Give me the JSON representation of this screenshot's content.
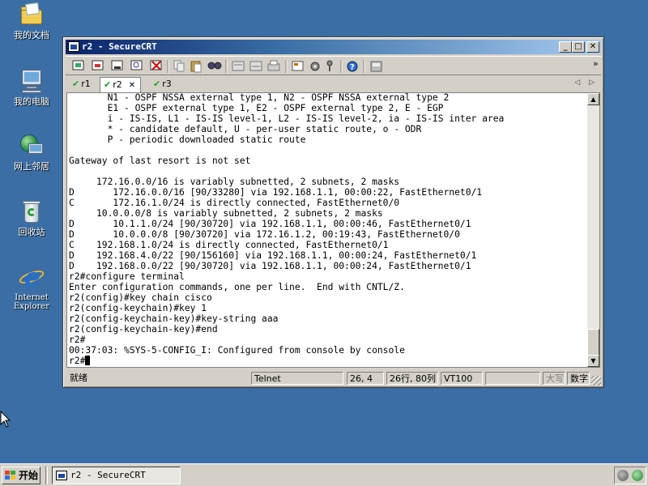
{
  "desktop": {
    "icons": [
      {
        "label": "我的文档"
      },
      {
        "label": "我的电脑"
      },
      {
        "label": "网上邻居"
      },
      {
        "label": "回收站"
      },
      {
        "label": "Internet Explorer"
      }
    ]
  },
  "window": {
    "title": "r2 - SecureCRT",
    "min_glyph": "_",
    "max_glyph": "□",
    "close_glyph": "✕",
    "tabs": [
      {
        "label": "r1",
        "active": false
      },
      {
        "label": "r2",
        "active": true
      },
      {
        "label": "r3",
        "active": false
      }
    ],
    "tab_close_glyph": "✕",
    "tab_nav_prev": "◁",
    "tab_nav_next": "▷",
    "terminal_text": "       N1 - OSPF NSSA external type 1, N2 - OSPF NSSA external type 2\n       E1 - OSPF external type 1, E2 - OSPF external type 2, E - EGP\n       i - IS-IS, L1 - IS-IS level-1, L2 - IS-IS level-2, ia - IS-IS inter area\n       * - candidate default, U - per-user static route, o - ODR\n       P - periodic downloaded static route\n\nGateway of last resort is not set\n\n     172.16.0.0/16 is variably subnetted, 2 subnets, 2 masks\nD       172.16.0.0/16 [90/33280] via 192.168.1.1, 00:00:22, FastEthernet0/1\nC       172.16.1.0/24 is directly connected, FastEthernet0/0\n     10.0.0.0/8 is variably subnetted, 2 subnets, 2 masks\nD       10.1.1.0/24 [90/30720] via 192.168.1.1, 00:00:46, FastEthernet0/1\nD       10.0.0.0/8 [90/30720] via 172.16.1.2, 00:19:43, FastEthernet0/0\nC    192.168.1.0/24 is directly connected, FastEthernet0/1\nD    192.168.4.0/22 [90/156160] via 192.168.1.1, 00:00:24, FastEthernet0/1\nD    192.168.0.0/22 [90/30720] via 192.168.1.1, 00:00:24, FastEthernet0/1\nr2#configure terminal\nEnter configuration commands, one per line.  End with CNTL/Z.\nr2(config)#key chain cisco\nr2(config-keychain)#key 1\nr2(config-keychain-key)#key-string aaa\nr2(config-keychain-key)#end\nr2#\n00:37:03: %SYS-5-CONFIG_I: Configured from console by console",
    "prompt": "r2#",
    "scroll_up": "▲",
    "scroll_down": "▼",
    "toolbar_more": "»"
  },
  "statusbar": {
    "ready": "就绪",
    "protocol": "Telnet",
    "cursor_pos": "26,  4",
    "rows_cols": "26行, 80列",
    "emulation": "VT100",
    "caps": "大写",
    "num": "数字"
  },
  "taskbar": {
    "start_label": "开始",
    "task_label": "r2 - SecureCRT"
  }
}
